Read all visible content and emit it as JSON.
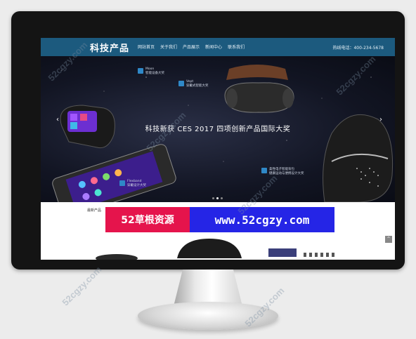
{
  "header": {
    "logo": "科技产品",
    "nav": [
      "网站首页",
      "关于我们",
      "产品展示",
      "新闻中心",
      "联系我们"
    ],
    "phone": "热线电话：400-234-5678"
  },
  "banner": {
    "title": "科技新获 CES 2017 四项创新产品国际大奖",
    "arrow_left": "‹",
    "arrow_right": "›",
    "awards": [
      {
        "name": "Moon",
        "desc": "智能设备大奖"
      },
      {
        "name": "Vept",
        "desc": "穿戴式智能大奖"
      },
      {
        "name": "Flexband",
        "desc": "穿戴设计大奖"
      },
      {
        "name": "柔性电子智能背包",
        "desc": "健康运动与便携设计大奖"
      }
    ]
  },
  "section": {
    "label": "最新产品",
    "ad_left": "52草根资源",
    "ad_right": "www.52cgzy.com",
    "scroll_top": "^"
  },
  "watermark": "52cgzy.com"
}
